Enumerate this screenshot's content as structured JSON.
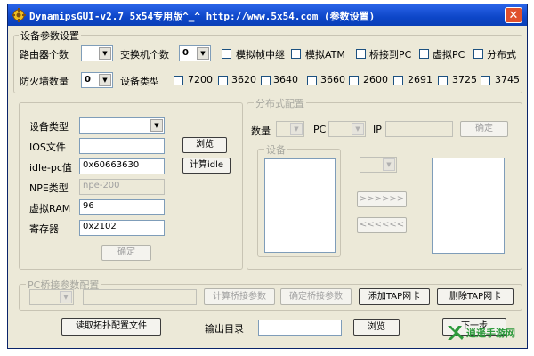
{
  "window": {
    "title": "DynamipsGUI-v2.7   5x54专用版^_^ http://www.5x54.com  (参数设置)",
    "close_glyph": "✕"
  },
  "device_params": {
    "legend": "设备参数设置",
    "router_count_label": "路由器个数",
    "router_count_value": "",
    "switch_count_label": "交换机个数",
    "switch_count_value": "0",
    "checks_row1": [
      "模拟帧中继",
      "模拟ATM",
      "桥接到PC",
      "虚拟PC",
      "分布式"
    ],
    "firewall_count_label": "防火墙数量",
    "firewall_count_value": "0",
    "device_type_label": "设备类型",
    "device_types": [
      "7200",
      "3620",
      "3640",
      "3660",
      "2600",
      "2691",
      "3725",
      "3745"
    ]
  },
  "config_form": {
    "device_type_label": "设备类型",
    "device_type_value": "",
    "ios_label": "IOS文件",
    "ios_value": "",
    "browse_label": "浏览",
    "idlepc_label": "idle-pc值",
    "idlepc_value": "0x60663630",
    "calc_idle_label": "计算idle",
    "npe_label": "NPE类型",
    "npe_value": "npe-200",
    "ram_label": "虚拟RAM",
    "ram_value": "96",
    "register_label": "寄存器",
    "register_value": "0x2102",
    "confirm_label": "确定"
  },
  "distributed": {
    "legend": "分布式配置",
    "count_label": "数量",
    "pc_label": "PC",
    "ip_label": "IP",
    "confirm_label": "确定",
    "device_legend": "设备",
    "forward_label": ">>>>>>",
    "back_label": "<<<<<<"
  },
  "pc_bridge": {
    "legend": "PC桥接参数配置",
    "calc_label": "计算桥接参数",
    "confirm_label": "确定桥接参数",
    "add_tap_label": "添加TAP网卡",
    "del_tap_label": "删除TAP网卡"
  },
  "bottom": {
    "read_topo_label": "读取拓扑配置文件",
    "output_dir_label": "输出目录",
    "output_dir_value": "",
    "browse_label": "浏览",
    "next_label": "下一步"
  },
  "watermark": {
    "text": "逍遥手游网",
    "color": "#2e9a3c"
  },
  "colors": {
    "titlebar": "#0d46c8",
    "close": "#e0502c",
    "window_bg": "#ece9d8"
  }
}
